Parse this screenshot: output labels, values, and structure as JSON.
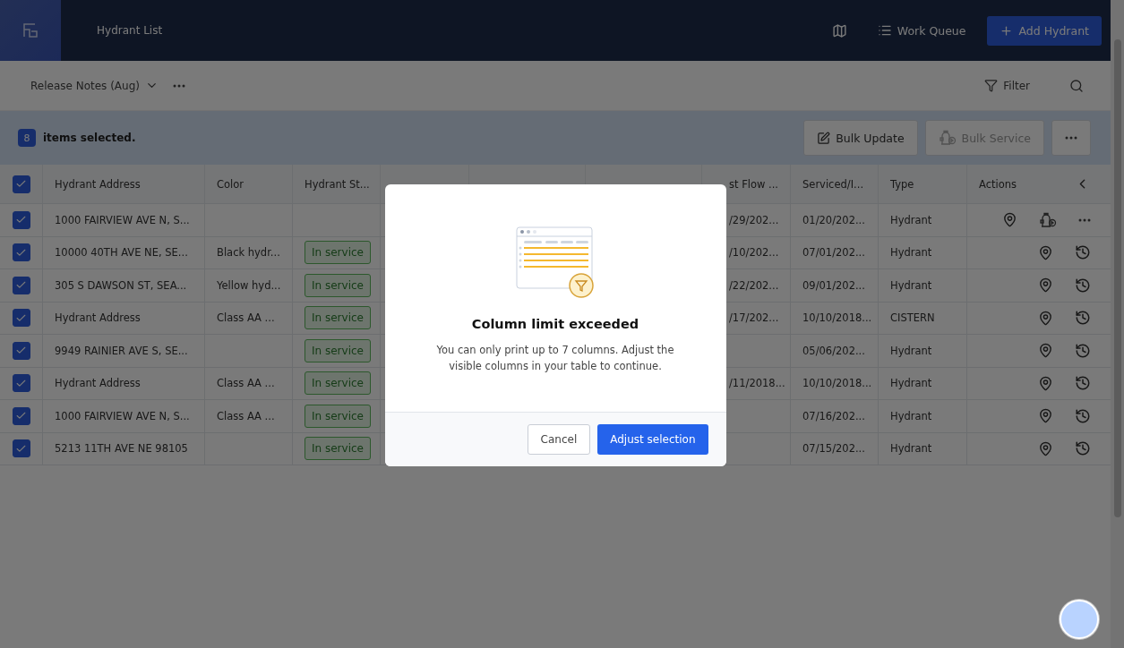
{
  "header": {
    "title": "Hydrant List",
    "work_queue": "Work Queue",
    "add_button": "Add Hydrant"
  },
  "toolbar": {
    "view": "Release Notes (Aug)",
    "filter": "Filter"
  },
  "selection": {
    "count": "8",
    "label": "items selected.",
    "bulk_update": "Bulk Update",
    "bulk_service": "Bulk Service",
    "bulk_service_disabled": true
  },
  "table": {
    "all_checked": true,
    "columns": [
      {
        "label": "Hydrant Address"
      },
      {
        "label": "Color"
      },
      {
        "label": "Hydrant St..."
      },
      {},
      {},
      {},
      {
        "label": "st Flow ..."
      },
      {
        "label": "Serviced/I..."
      },
      {
        "label": "Type"
      },
      {
        "label": "Actions"
      }
    ],
    "rows": [
      {
        "checked": true,
        "kind": "full",
        "address": "1000 FAIRVIEW AVE N, S...",
        "last_flow": "/29/202...",
        "serviced": "01/20/202...",
        "type": "Hydrant"
      },
      {
        "checked": true,
        "kind": "compact",
        "address": "10000 40TH AVE NE, SE...",
        "hydrant_color": "Black hydr...",
        "status": "In service",
        "last_flow": "/10/202...",
        "serviced": "07/01/202...",
        "type": "Hydrant"
      },
      {
        "checked": true,
        "kind": "compact",
        "address": "305 S DAWSON ST, SEA...",
        "hydrant_color": "Yellow hyd...",
        "status": "In service",
        "last_flow": "/22/202...",
        "serviced": "09/01/202...",
        "type": "Hydrant"
      },
      {
        "checked": true,
        "kind": "compact",
        "address": "Hydrant Address",
        "hydrant_color": "Class AA ...",
        "status": "In service",
        "last_flow": "/17/202...",
        "serviced": "10/10/2018...",
        "type": "CISTERN"
      },
      {
        "checked": true,
        "kind": "compact",
        "address": "9949 RAINIER AVE S, SE...",
        "status": "In service",
        "serviced": "05/06/202...",
        "type": "Hydrant"
      },
      {
        "checked": true,
        "kind": "compact",
        "address": "Hydrant Address",
        "hydrant_color": "Class AA ...",
        "status": "In service",
        "last_flow": "/11/2018...",
        "serviced": "10/10/2018...",
        "type": "Hydrant"
      },
      {
        "checked": true,
        "kind": "compact",
        "address": "1000 FAIRVIEW AVE N, S...",
        "hydrant_color": "Class AA ...",
        "status": "In service",
        "serviced": "07/16/202...",
        "type": "Hydrant"
      },
      {
        "checked": true,
        "kind": "compact",
        "address": "5213 11TH AVE NE 98105",
        "status": "In service",
        "serviced": "07/15/202...",
        "type": "Hydrant"
      }
    ]
  },
  "dialog": {
    "title": "Column limit exceeded",
    "message": "You can only print up to 7 columns. Adjust the visible columns in your table to continue.",
    "cancel": "Cancel",
    "confirm": "Adjust selection"
  }
}
